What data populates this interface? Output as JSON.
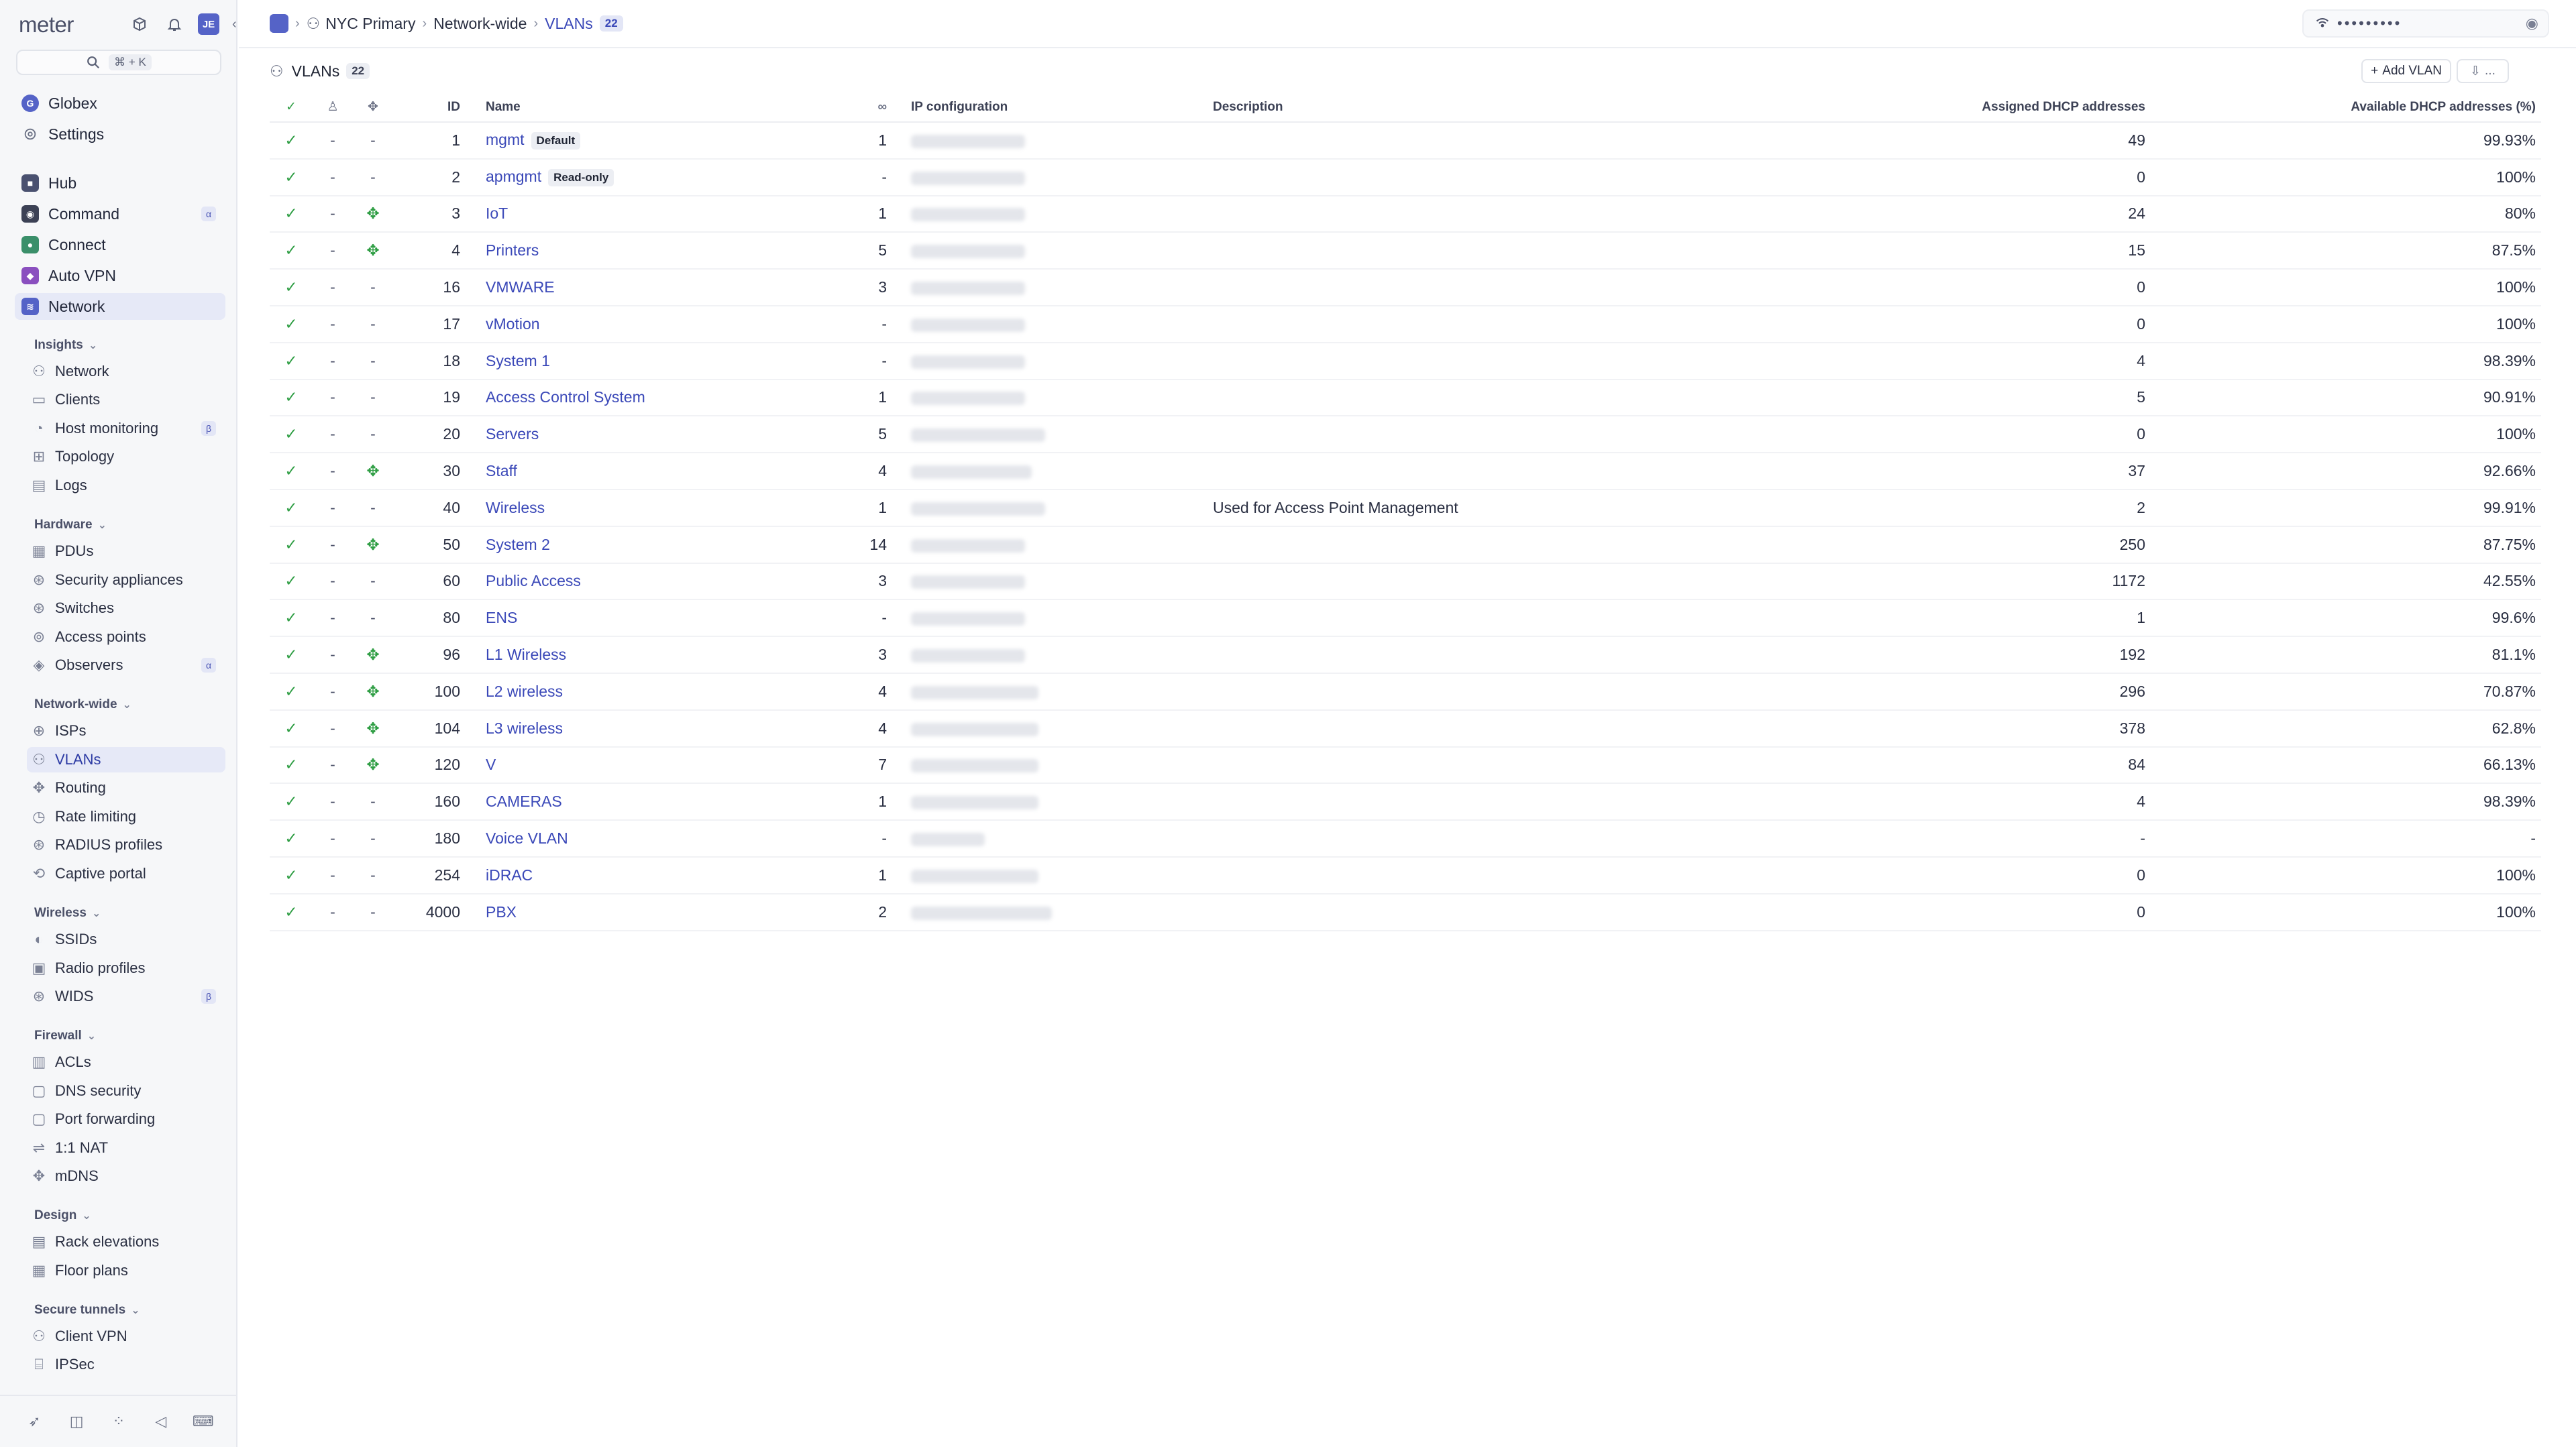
{
  "app": {
    "logo": "meter",
    "search_shortcut": "⌘ + K",
    "avatar_initials": "JE"
  },
  "sidebar": {
    "org": "Globex",
    "settings": "Settings",
    "products": [
      {
        "label": "Hub",
        "icon": "hub-icon",
        "color": "#4a5170"
      },
      {
        "label": "Command",
        "icon": "command-icon",
        "color": "#3c4155",
        "badge": "α"
      },
      {
        "label": "Connect",
        "icon": "connect-icon",
        "color": "#3a8f6a"
      },
      {
        "label": "Auto VPN",
        "icon": "auto-vpn-icon",
        "color": "#8a4fbf"
      },
      {
        "label": "Network",
        "icon": "network-icon",
        "color": "#5563c7"
      }
    ],
    "sections": [
      {
        "title": "Insights",
        "items": [
          {
            "label": "Network",
            "icon": "network-insight-icon"
          },
          {
            "label": "Clients",
            "icon": "clients-icon"
          },
          {
            "label": "Host monitoring",
            "icon": "host-monitoring-icon",
            "badge": "β"
          },
          {
            "label": "Topology",
            "icon": "topology-icon"
          },
          {
            "label": "Logs",
            "icon": "logs-icon"
          }
        ]
      },
      {
        "title": "Hardware",
        "items": [
          {
            "label": "PDUs",
            "icon": "pdu-icon"
          },
          {
            "label": "Security appliances",
            "icon": "security-appliance-icon"
          },
          {
            "label": "Switches",
            "icon": "switch-icon"
          },
          {
            "label": "Access points",
            "icon": "access-point-icon"
          },
          {
            "label": "Observers",
            "icon": "observer-icon",
            "badge": "α"
          }
        ]
      },
      {
        "title": "Network-wide",
        "items": [
          {
            "label": "ISPs",
            "icon": "globe-icon"
          },
          {
            "label": "VLANs",
            "icon": "vlan-icon"
          },
          {
            "label": "Routing",
            "icon": "routing-icon"
          },
          {
            "label": "Rate limiting",
            "icon": "rate-limit-icon"
          },
          {
            "label": "RADIUS profiles",
            "icon": "radius-icon"
          },
          {
            "label": "Captive portal",
            "icon": "captive-portal-icon"
          }
        ]
      },
      {
        "title": "Wireless",
        "items": [
          {
            "label": "SSIDs",
            "icon": "ssid-icon"
          },
          {
            "label": "Radio profiles",
            "icon": "radio-profile-icon"
          },
          {
            "label": "WIDS",
            "icon": "wids-icon",
            "badge": "β"
          }
        ]
      },
      {
        "title": "Firewall",
        "items": [
          {
            "label": "ACLs",
            "icon": "acl-icon"
          },
          {
            "label": "DNS security",
            "icon": "dns-security-icon"
          },
          {
            "label": "Port forwarding",
            "icon": "port-forwarding-icon"
          },
          {
            "label": "1:1 NAT",
            "icon": "nat-icon"
          },
          {
            "label": "mDNS",
            "icon": "mdns-icon"
          }
        ]
      },
      {
        "title": "Design",
        "items": [
          {
            "label": "Rack elevations",
            "icon": "rack-icon"
          },
          {
            "label": "Floor plans",
            "icon": "floor-plan-icon"
          }
        ]
      },
      {
        "title": "Secure tunnels",
        "items": [
          {
            "label": "Client VPN",
            "icon": "client-vpn-icon"
          },
          {
            "label": "IPSec",
            "icon": "ipsec-icon"
          }
        ]
      }
    ]
  },
  "breadcrumb": {
    "site": "NYC Primary",
    "section": "Network-wide",
    "page": "VLANs",
    "count": "22"
  },
  "wifi": {
    "password_mask": "•••••••••"
  },
  "page": {
    "title": "VLANs",
    "count": "22",
    "add_button": "Add VLAN",
    "more_button": "..."
  },
  "table": {
    "headers": {
      "id": "ID",
      "name": "Name",
      "ip": "IP configuration",
      "description": "Description",
      "assigned": "Assigned DHCP addresses",
      "available": "Available DHCP addresses (%)"
    },
    "rows": [
      {
        "id": "1",
        "name": "mgmt",
        "tag": "Default",
        "a": "-",
        "b": "-",
        "count": "1",
        "desc": "",
        "assigned": "49",
        "available": "99.93%"
      },
      {
        "id": "2",
        "name": "apmgmt",
        "tag": "Read-only",
        "a": "-",
        "b": "-",
        "count": "-",
        "desc": "",
        "assigned": "0",
        "available": "100%"
      },
      {
        "id": "3",
        "name": "IoT",
        "tag": "",
        "a": "-",
        "b": "icon",
        "count": "1",
        "desc": "",
        "assigned": "24",
        "available": "80%"
      },
      {
        "id": "4",
        "name": "Printers",
        "tag": "",
        "a": "-",
        "b": "icon",
        "count": "5",
        "desc": "",
        "assigned": "15",
        "available": "87.5%"
      },
      {
        "id": "16",
        "name": "VMWARE",
        "tag": "",
        "a": "-",
        "b": "-",
        "count": "3",
        "desc": "",
        "assigned": "0",
        "available": "100%"
      },
      {
        "id": "17",
        "name": "vMotion",
        "tag": "",
        "a": "-",
        "b": "-",
        "count": "-",
        "desc": "",
        "assigned": "0",
        "available": "100%"
      },
      {
        "id": "18",
        "name": "System 1",
        "tag": "",
        "a": "-",
        "b": "-",
        "count": "-",
        "desc": "",
        "assigned": "4",
        "available": "98.39%"
      },
      {
        "id": "19",
        "name": "Access Control System",
        "tag": "",
        "a": "-",
        "b": "-",
        "count": "1",
        "desc": "",
        "assigned": "5",
        "available": "90.91%"
      },
      {
        "id": "20",
        "name": "Servers",
        "tag": "",
        "a": "-",
        "b": "-",
        "count": "5",
        "desc": "",
        "assigned": "0",
        "available": "100%"
      },
      {
        "id": "30",
        "name": "Staff",
        "tag": "",
        "a": "-",
        "b": "icon",
        "count": "4",
        "desc": "",
        "assigned": "37",
        "available": "92.66%"
      },
      {
        "id": "40",
        "name": "Wireless",
        "tag": "",
        "a": "-",
        "b": "-",
        "count": "1",
        "desc": "Used for Access Point Management",
        "assigned": "2",
        "available": "99.91%"
      },
      {
        "id": "50",
        "name": "System 2",
        "tag": "",
        "a": "-",
        "b": "icon",
        "count": "14",
        "desc": "",
        "assigned": "250",
        "available": "87.75%"
      },
      {
        "id": "60",
        "name": "Public Access",
        "tag": "",
        "a": "-",
        "b": "-",
        "count": "3",
        "desc": "",
        "assigned": "1172",
        "available": "42.55%"
      },
      {
        "id": "80",
        "name": "ENS",
        "tag": "",
        "a": "-",
        "b": "-",
        "count": "-",
        "desc": "",
        "assigned": "1",
        "available": "99.6%"
      },
      {
        "id": "96",
        "name": "L1 Wireless",
        "tag": "",
        "a": "-",
        "b": "icon",
        "count": "3",
        "desc": "",
        "assigned": "192",
        "available": "81.1%"
      },
      {
        "id": "100",
        "name": "L2 wireless",
        "tag": "",
        "a": "-",
        "b": "icon",
        "count": "4",
        "desc": "",
        "assigned": "296",
        "available": "70.87%"
      },
      {
        "id": "104",
        "name": "L3 wireless",
        "tag": "",
        "a": "-",
        "b": "icon",
        "count": "4",
        "desc": "",
        "assigned": "378",
        "available": "62.8%"
      },
      {
        "id": "120",
        "name": "V",
        "tag": "",
        "a": "-",
        "b": "icon",
        "count": "7",
        "desc": "",
        "assigned": "84",
        "available": "66.13%"
      },
      {
        "id": "160",
        "name": "CAMERAS",
        "tag": "",
        "a": "-",
        "b": "-",
        "count": "1",
        "desc": "",
        "assigned": "4",
        "available": "98.39%"
      },
      {
        "id": "180",
        "name": "Voice VLAN",
        "tag": "",
        "a": "-",
        "b": "-",
        "count": "-",
        "desc": "",
        "assigned": "-",
        "available": "-"
      },
      {
        "id": "254",
        "name": "iDRAC",
        "tag": "",
        "a": "-",
        "b": "-",
        "count": "1",
        "desc": "",
        "assigned": "0",
        "available": "100%"
      },
      {
        "id": "4000",
        "name": "PBX",
        "tag": "",
        "a": "-",
        "b": "-",
        "count": "2",
        "desc": "",
        "assigned": "0",
        "available": "100%"
      }
    ]
  },
  "colors": {
    "accent": "#5563c7",
    "link": "#3a48b8",
    "success": "#2f9e44"
  }
}
